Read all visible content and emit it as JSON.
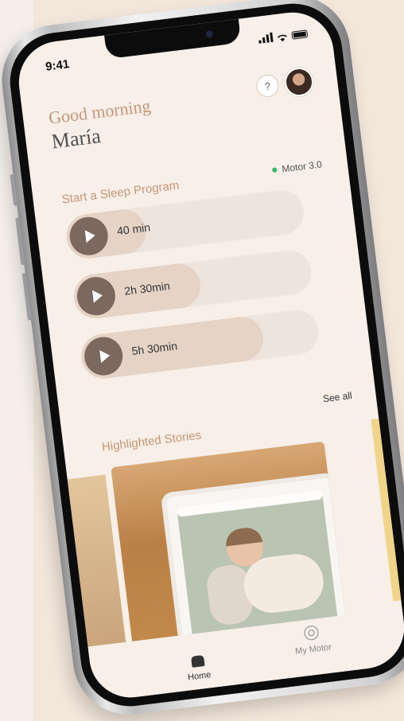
{
  "status_bar": {
    "time": "9:41"
  },
  "header": {
    "greeting": "Good morning",
    "user_name": "María",
    "help_label": "?"
  },
  "sleep_programs": {
    "title": "Start a Sleep Program",
    "device_label": "Motor 3.0",
    "items": [
      {
        "label": "40 min"
      },
      {
        "label": "2h 30min"
      },
      {
        "label": "5h 30min"
      }
    ]
  },
  "stories": {
    "title": "Highlighted Stories",
    "see_all": "See all"
  },
  "tabbar": {
    "home_label": "Home",
    "motor_label": "My Motor"
  },
  "icons": {
    "play": "play-icon",
    "home": "home-icon",
    "motor": "motor-icon",
    "help": "question-icon"
  },
  "colors": {
    "accent": "#c79676",
    "screen_bg": "#f7efe8",
    "status_online": "#37b86b",
    "play_button": "#7b6960"
  }
}
